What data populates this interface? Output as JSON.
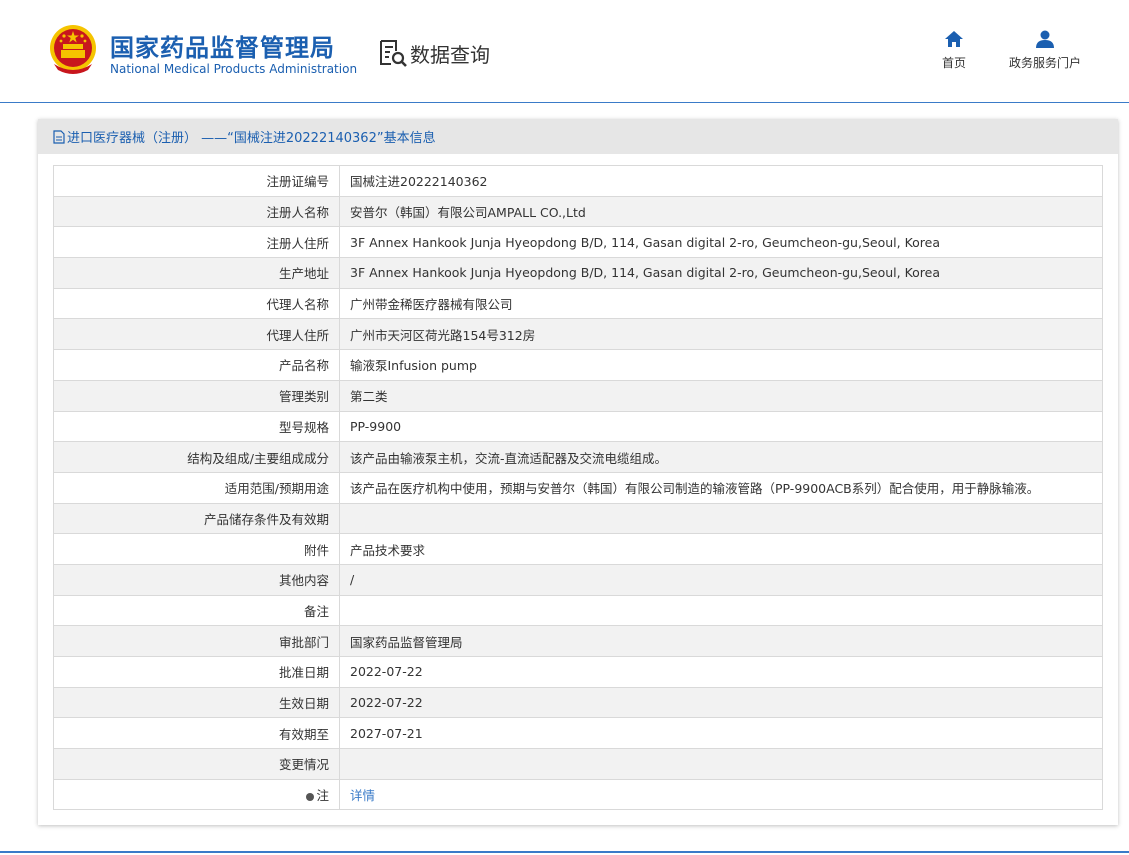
{
  "header": {
    "org_name_cn": "国家药品监督管理局",
    "org_name_en": "National Medical Products Administration",
    "section_title": "数据查询",
    "nav": [
      {
        "label": "首页",
        "icon": "home-icon"
      },
      {
        "label": "政务服务门户",
        "icon": "user-icon"
      }
    ]
  },
  "colors": {
    "brand_blue": "#1b5fb0",
    "link_blue": "#3a7bc8",
    "emblem_red": "#c8161d",
    "emblem_gold": "#f5c400"
  },
  "panel": {
    "title": "进口医疗器械（注册） ——“国械注进20222140362”基本信息"
  },
  "rows": [
    {
      "label": "注册证编号",
      "value": "国械注进20222140362"
    },
    {
      "label": "注册人名称",
      "value": "安普尔（韩国）有限公司AMPALL CO.,Ltd"
    },
    {
      "label": "注册人住所",
      "value": "3F Annex Hankook Junja Hyeopdong B/D, 114, Gasan digital 2-ro, Geumcheon-gu,Seoul, Korea"
    },
    {
      "label": "生产地址",
      "value": "3F Annex Hankook Junja Hyeopdong B/D, 114, Gasan digital 2-ro, Geumcheon-gu,Seoul, Korea"
    },
    {
      "label": "代理人名称",
      "value": "广州带金稀医疗器械有限公司"
    },
    {
      "label": "代理人住所",
      "value": "广州市天河区荷光路154号312房"
    },
    {
      "label": "产品名称",
      "value": "输液泵Infusion pump"
    },
    {
      "label": "管理类别",
      "value": "第二类"
    },
    {
      "label": "型号规格",
      "value": "PP-9900"
    },
    {
      "label": "结构及组成/主要组成成分",
      "value": "该产品由输液泵主机，交流-直流适配器及交流电缆组成。"
    },
    {
      "label": "适用范围/预期用途",
      "value": "该产品在医疗机构中使用，预期与安普尔（韩国）有限公司制造的输液管路（PP-9900ACB系列）配合使用，用于静脉输液。"
    },
    {
      "label": "产品储存条件及有效期",
      "value": ""
    },
    {
      "label": "附件",
      "value": "产品技术要求"
    },
    {
      "label": "其他内容",
      "value": "/"
    },
    {
      "label": "备注",
      "value": ""
    },
    {
      "label": "审批部门",
      "value": "国家药品监督管理局"
    },
    {
      "label": "批准日期",
      "value": "2022-07-22"
    },
    {
      "label": "生效日期",
      "value": "2022-07-22"
    },
    {
      "label": "有效期至",
      "value": "2027-07-21"
    },
    {
      "label": "变更情况",
      "value": ""
    }
  ],
  "note_row": {
    "label": "注",
    "value": "详情"
  }
}
